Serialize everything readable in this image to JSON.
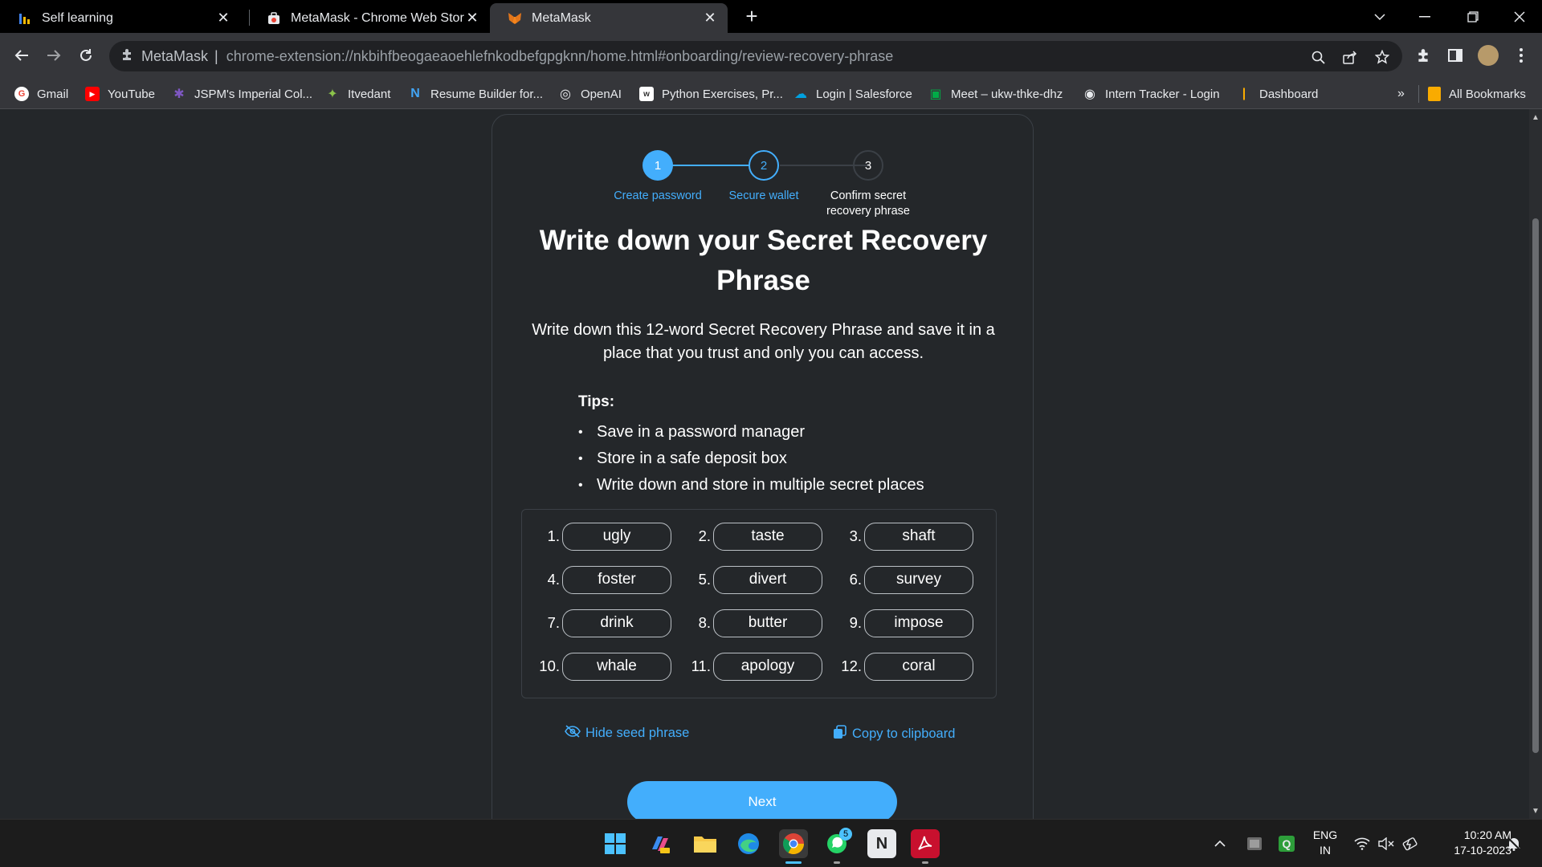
{
  "tabs": [
    {
      "title": "Self learning",
      "icon": "bar-chart-icon"
    },
    {
      "title": "MetaMask - Chrome Web Store",
      "icon": "web-store-icon"
    },
    {
      "title": "MetaMask",
      "icon": "fox-icon"
    }
  ],
  "address_bar": {
    "site_name": "MetaMask",
    "url": "chrome-extension://nkbihfbeogaeaoehlefnkodbefgpgknn/home.html#onboarding/review-recovery-phrase"
  },
  "bookmarks": [
    {
      "label": "Gmail",
      "color": "#ea4335",
      "glyph": "G"
    },
    {
      "label": "YouTube",
      "color": "#ff0000",
      "glyph": "▶"
    },
    {
      "label": "JSPM's Imperial Col...",
      "color": "#5b3fb5",
      "glyph": "✱"
    },
    {
      "label": "Itvedant",
      "color": "#8bc34a",
      "glyph": "✦"
    },
    {
      "label": "Resume Builder for...",
      "color": "#1e88e5",
      "glyph": "N"
    },
    {
      "label": "OpenAI",
      "color": "#5f6368",
      "glyph": "◎"
    },
    {
      "label": "Python Exercises, Pr...",
      "color": "#ffffff",
      "glyph": "w"
    },
    {
      "label": "Login | Salesforce",
      "color": "#00a1e0",
      "glyph": "☁"
    },
    {
      "label": "Meet – ukw-thke-dhz",
      "color": "#00897b",
      "glyph": "▣"
    },
    {
      "label": "Intern Tracker - Login",
      "color": "#e8eaed",
      "glyph": "◉"
    },
    {
      "label": "Dashboard",
      "color": "#f9ab00",
      "glyph": "|"
    }
  ],
  "all_bookmarks_label": "All Bookmarks",
  "overflow_label": "»",
  "stepper": [
    {
      "number": "1",
      "label": "Create password",
      "state": "complete"
    },
    {
      "number": "2",
      "label": "Secure wallet",
      "state": "current"
    },
    {
      "number": "3",
      "label": "Confirm secret recovery phrase",
      "state": "upcoming"
    }
  ],
  "heading": "Write down your Secret Recovery Phrase",
  "description": "Write down this 12-word Secret Recovery Phrase and save it in a place that you trust and only you can access.",
  "tips_title": "Tips:",
  "tips": [
    "Save in a password manager",
    "Store in a safe deposit box",
    "Write down and store in multiple secret places"
  ],
  "words": [
    {
      "num": "1.",
      "word": "ugly"
    },
    {
      "num": "2.",
      "word": "taste"
    },
    {
      "num": "3.",
      "word": "shaft"
    },
    {
      "num": "4.",
      "word": "foster"
    },
    {
      "num": "5.",
      "word": "divert"
    },
    {
      "num": "6.",
      "word": "survey"
    },
    {
      "num": "7.",
      "word": "drink"
    },
    {
      "num": "8.",
      "word": "butter"
    },
    {
      "num": "9.",
      "word": "impose"
    },
    {
      "num": "10.",
      "word": "whale"
    },
    {
      "num": "11.",
      "word": "apology"
    },
    {
      "num": "12.",
      "word": "coral"
    }
  ],
  "hide_seed_label": "Hide seed phrase",
  "copy_label": "Copy to clipboard",
  "next_label": "Next",
  "taskbar": {
    "whatsapp_badge": "5",
    "lang_top": "ENG",
    "lang_bottom": "IN",
    "time": "10:20 AM",
    "date": "17-10-2023"
  },
  "colors": {
    "accent": "#43aefc",
    "page_bg": "#24272a",
    "text": "#ffffff"
  }
}
